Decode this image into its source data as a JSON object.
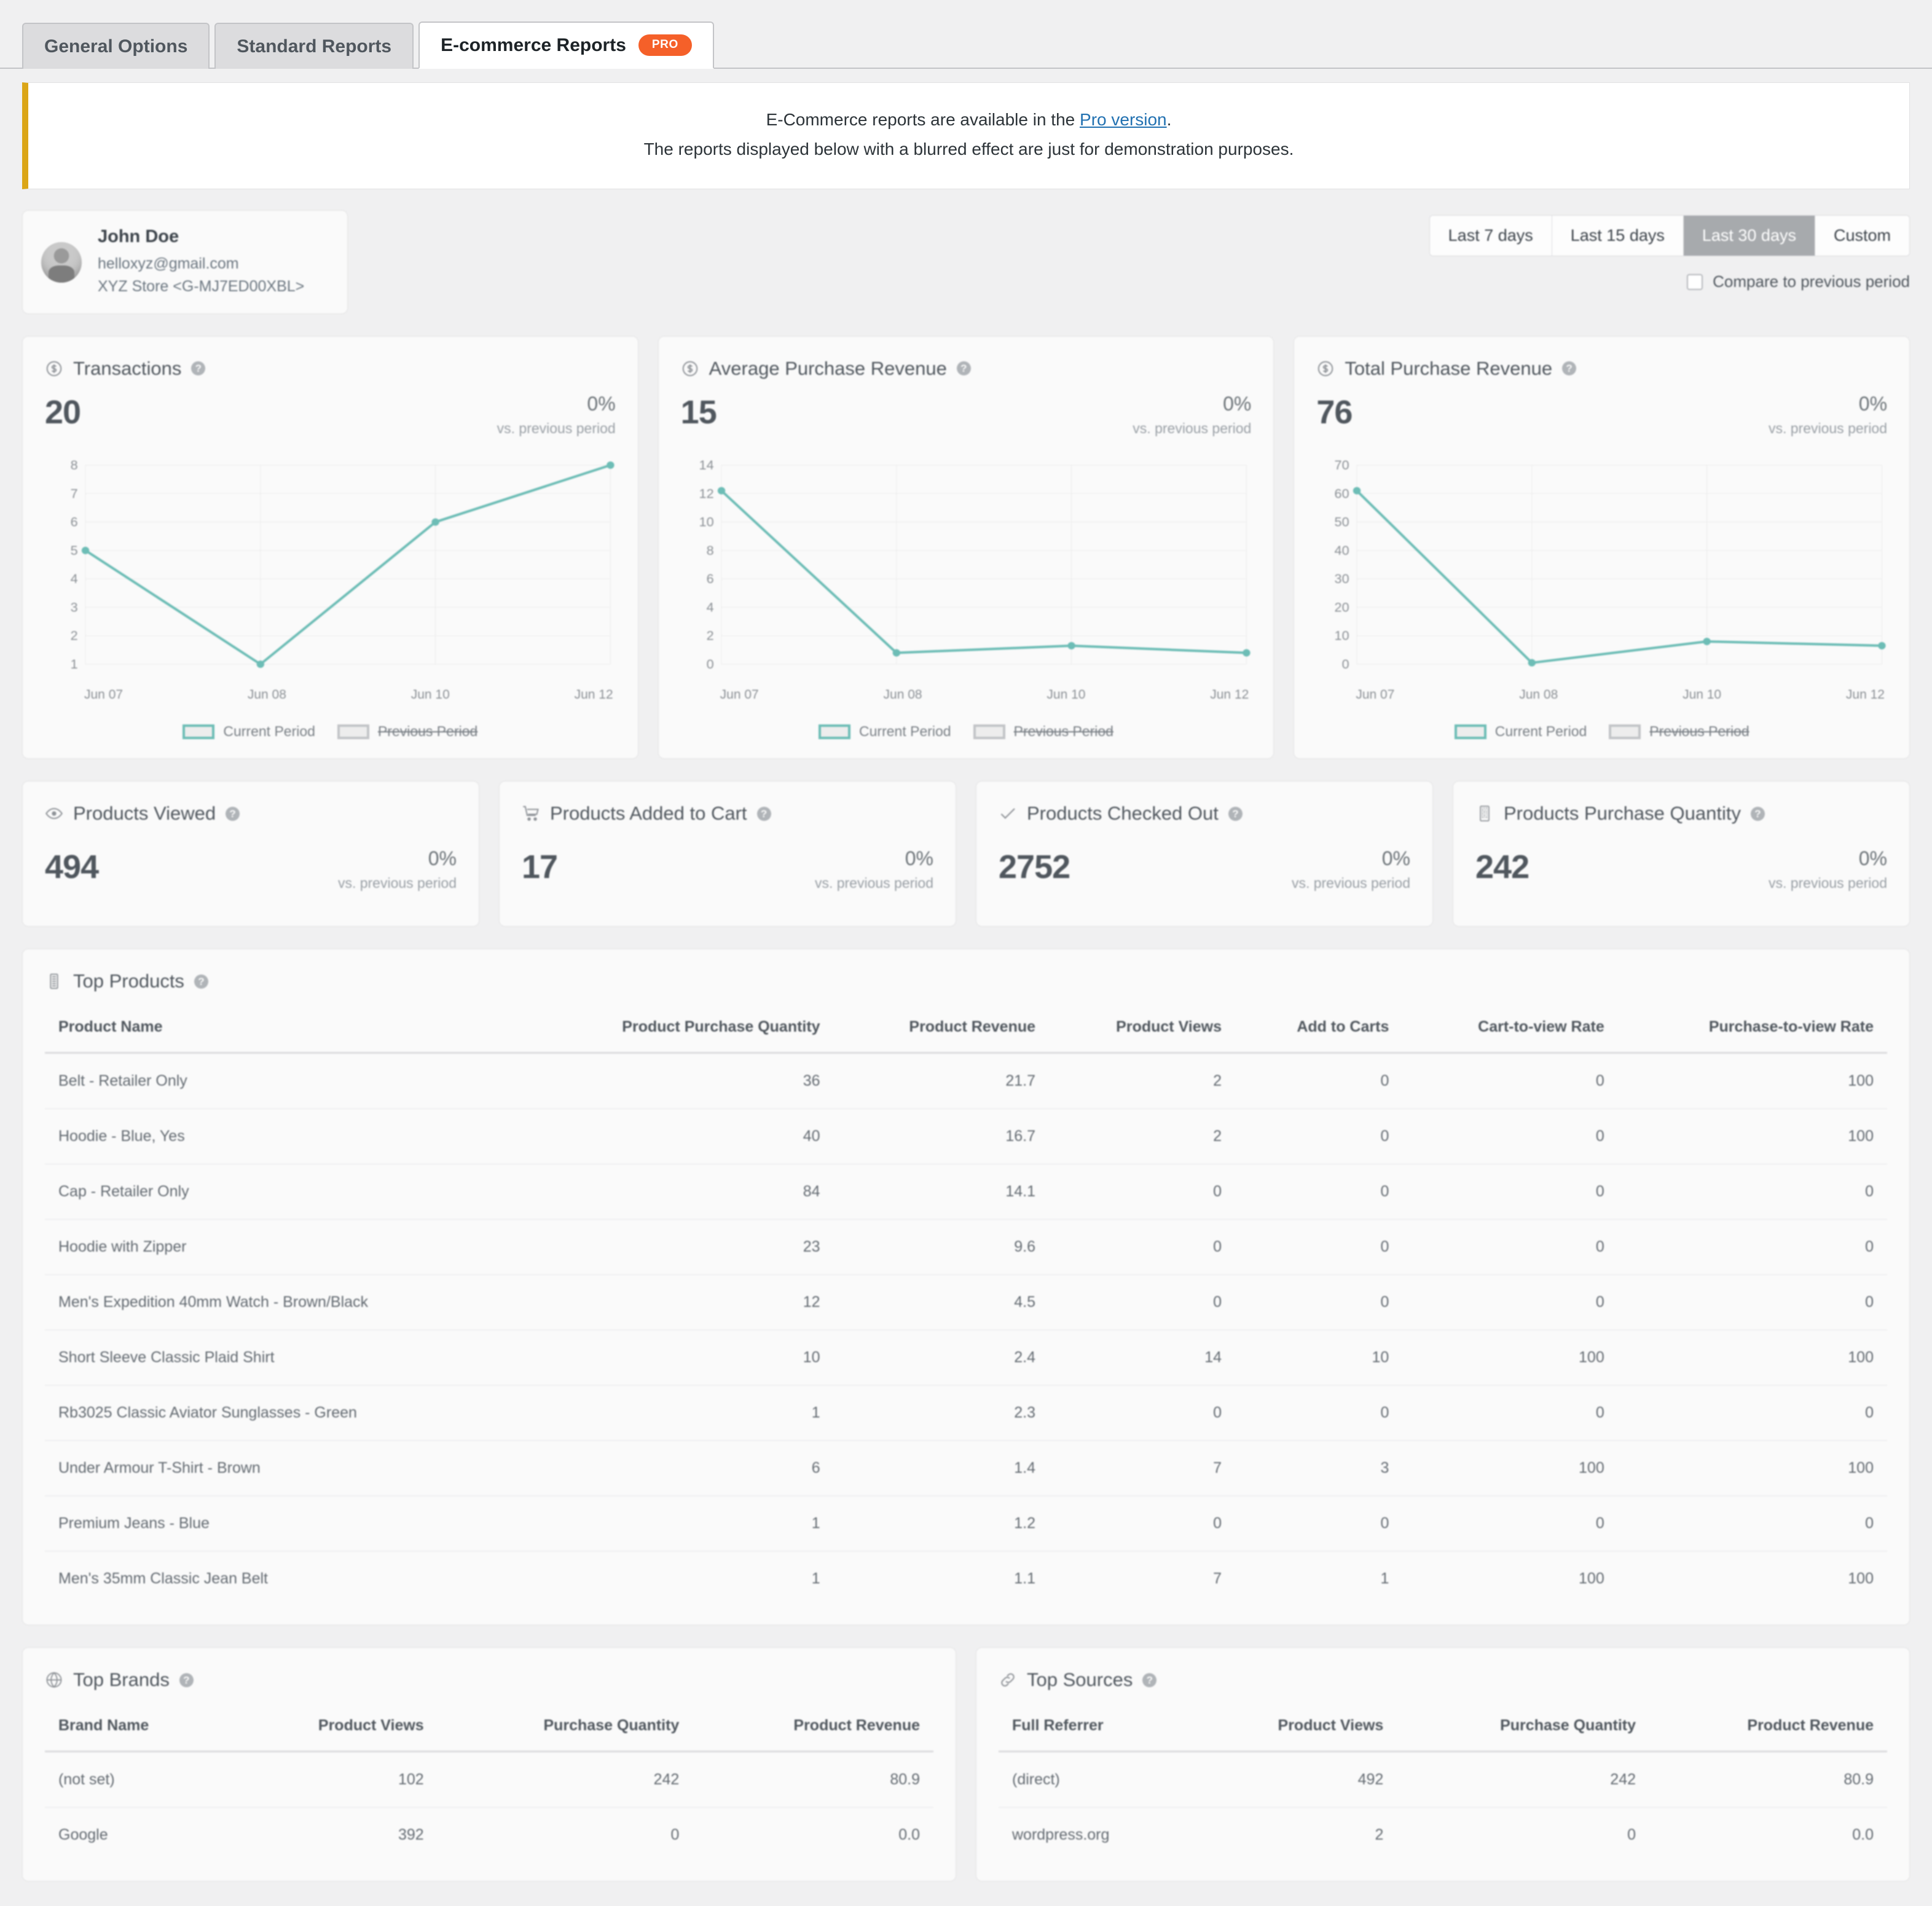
{
  "tabs": [
    {
      "label": "General Options",
      "active": false,
      "badge": null
    },
    {
      "label": "Standard Reports",
      "active": false,
      "badge": null
    },
    {
      "label": "E-commerce Reports",
      "active": true,
      "badge": "PRO"
    }
  ],
  "notice": {
    "line1_before": "E-Commerce reports are available in the ",
    "line1_link": "Pro version",
    "line1_after": ".",
    "line2": "The reports displayed below with a blurred effect are just for demonstration purposes."
  },
  "profile": {
    "name": "John Doe",
    "email": "helloxyz@gmail.com",
    "property": "XYZ Store <G-MJ7ED00XBL>"
  },
  "daterange": {
    "options": [
      "Last 7 days",
      "Last 15 days",
      "Last 30 days",
      "Custom"
    ],
    "selected": "Last 30 days",
    "compare_label": "Compare to previous period",
    "compare_checked": false
  },
  "delta_label": "vs. previous period",
  "legend": {
    "current": "Current Period",
    "previous": "Previous Period"
  },
  "chart_cards": [
    {
      "icon": "dollar-circle-icon",
      "title": "Transactions",
      "value": "20",
      "delta": "0%"
    },
    {
      "icon": "dollar-circle-icon",
      "title": "Average Purchase Revenue",
      "value": "15",
      "delta": "0%"
    },
    {
      "icon": "dollar-circle-icon",
      "title": "Total Purchase Revenue",
      "value": "76",
      "delta": "0%"
    }
  ],
  "stat_cards": [
    {
      "icon": "eye-icon",
      "title": "Products Viewed",
      "value": "494",
      "delta": "0%"
    },
    {
      "icon": "cart-icon",
      "title": "Products Added to Cart",
      "value": "17",
      "delta": "0%"
    },
    {
      "icon": "check-icon",
      "title": "Products Checked Out",
      "value": "2752",
      "delta": "0%"
    },
    {
      "icon": "barcode-icon",
      "title": "Products Purchase Quantity",
      "value": "242",
      "delta": "0%"
    }
  ],
  "top_products": {
    "title": "Top Products",
    "icon": "list-icon",
    "columns": [
      "Product Name",
      "Product Purchase Quantity",
      "Product Revenue",
      "Product Views",
      "Add to Carts",
      "Cart-to-view Rate",
      "Purchase-to-view Rate"
    ],
    "rows": [
      [
        "Belt - Retailer Only",
        "36",
        "21.7",
        "2",
        "0",
        "0",
        "100"
      ],
      [
        "Hoodie - Blue, Yes",
        "40",
        "16.7",
        "2",
        "0",
        "0",
        "100"
      ],
      [
        "Cap - Retailer Only",
        "84",
        "14.1",
        "0",
        "0",
        "0",
        "0"
      ],
      [
        "Hoodie with Zipper",
        "23",
        "9.6",
        "0",
        "0",
        "0",
        "0"
      ],
      [
        "Men's Expedition 40mm Watch - Brown/Black",
        "12",
        "4.5",
        "0",
        "0",
        "0",
        "0"
      ],
      [
        "Short Sleeve Classic Plaid Shirt",
        "10",
        "2.4",
        "14",
        "10",
        "100",
        "100"
      ],
      [
        "Rb3025 Classic Aviator Sunglasses - Green",
        "1",
        "2.3",
        "0",
        "0",
        "0",
        "0"
      ],
      [
        "Under Armour T-Shirt - Brown",
        "6",
        "1.4",
        "7",
        "3",
        "100",
        "100"
      ],
      [
        "Premium Jeans - Blue",
        "1",
        "1.2",
        "0",
        "0",
        "0",
        "0"
      ],
      [
        "Men's 35mm Classic Jean Belt",
        "1",
        "1.1",
        "7",
        "1",
        "100",
        "100"
      ]
    ]
  },
  "top_brands": {
    "title": "Top Brands",
    "icon": "globe-icon",
    "columns": [
      "Brand Name",
      "Product Views",
      "Purchase Quantity",
      "Product Revenue"
    ],
    "rows": [
      [
        "(not set)",
        "102",
        "242",
        "80.9"
      ],
      [
        "Google",
        "392",
        "0",
        "0.0"
      ]
    ]
  },
  "top_sources": {
    "title": "Top Sources",
    "icon": "link-icon",
    "columns": [
      "Full Referrer",
      "Product Views",
      "Purchase Quantity",
      "Product Revenue"
    ],
    "rows": [
      [
        "(direct)",
        "492",
        "242",
        "80.9"
      ],
      [
        "wordpress.org",
        "2",
        "0",
        "0.0"
      ]
    ]
  },
  "colors": {
    "accent_teal": "#6dbdb6",
    "pro_badge": "#f56029",
    "notice_border": "#dba617",
    "link": "#2271b1",
    "active_range": "#a7aaad"
  },
  "chart_data": [
    {
      "type": "line",
      "title": "Transactions",
      "x": [
        "Jun 07",
        "Jun 08",
        "Jun 10",
        "Jun 12"
      ],
      "series": [
        {
          "name": "Current Period",
          "values": [
            5,
            1,
            6,
            8
          ]
        }
      ],
      "yticks": [
        1,
        2,
        3,
        4,
        5,
        6,
        7,
        8
      ],
      "ylim": [
        1,
        8
      ],
      "xlabel": "",
      "ylabel": "",
      "grid": true,
      "legend": [
        "Current Period",
        "Previous Period"
      ],
      "legend_position": "bottom"
    },
    {
      "type": "line",
      "title": "Average Purchase Revenue",
      "x": [
        "Jun 07",
        "Jun 08",
        "Jun 10",
        "Jun 12"
      ],
      "series": [
        {
          "name": "Current Period",
          "values": [
            12.2,
            0.8,
            1.3,
            0.8
          ]
        }
      ],
      "yticks": [
        0,
        2,
        4,
        6,
        8,
        10,
        12,
        14
      ],
      "ylim": [
        0,
        14
      ],
      "xlabel": "",
      "ylabel": "",
      "grid": true,
      "legend": [
        "Current Period",
        "Previous Period"
      ],
      "legend_position": "bottom"
    },
    {
      "type": "line",
      "title": "Total Purchase Revenue",
      "x": [
        "Jun 07",
        "Jun 08",
        "Jun 10",
        "Jun 12"
      ],
      "series": [
        {
          "name": "Current Period",
          "values": [
            61,
            0.5,
            8,
            6.5
          ]
        }
      ],
      "yticks": [
        0,
        10,
        20,
        30,
        40,
        50,
        60,
        70
      ],
      "ylim": [
        0,
        70
      ],
      "xlabel": "",
      "ylabel": "",
      "grid": true,
      "legend": [
        "Current Period",
        "Previous Period"
      ],
      "legend_position": "bottom"
    }
  ]
}
